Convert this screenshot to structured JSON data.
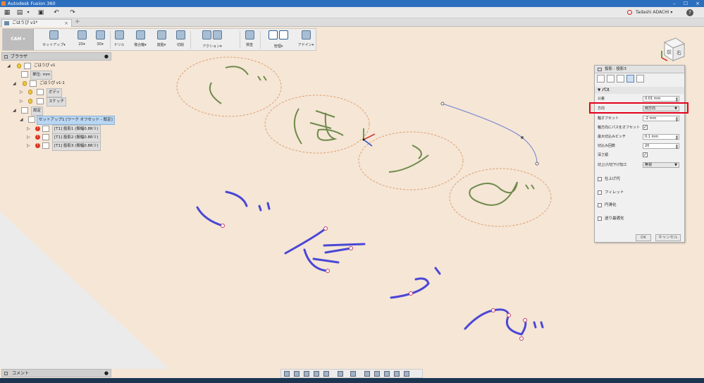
{
  "window": {
    "title": "Autodesk Fusion 360"
  },
  "qat": {
    "user_name": "Tadashi ADACHI ▾",
    "help": "?"
  },
  "doc_tab": {
    "label": "ごはうぴ v1*",
    "close": "×",
    "new_tab": "+"
  },
  "ribbon": {
    "workspace": "CAM ▾",
    "groups": [
      "セットアップ▾",
      "2D▾",
      "3D▾",
      "ドリル",
      "複合軸▾",
      "旋盤▾",
      "切削",
      "アクション▾",
      "検査",
      "管理▾",
      "アドイン▾"
    ]
  },
  "browser": {
    "title": "ブラウザ",
    "nodes": {
      "root": "ごはうぴ v1",
      "units": "単位: mm",
      "component": "ごはうぴ v1:1",
      "bodies": "ボディ",
      "sketches": "スケッチ",
      "setups": "設定",
      "setup1": "セットアップ1 [ワーク オフセット - 既定]",
      "op1": "[T1] 投影1 (振幅0.8Rリ)",
      "op2": "[T1] 投影2 (振幅0.8Rリ)",
      "op3": "[T1] 投影3 (振幅0.8Rリ)"
    }
  },
  "panel": {
    "title": "投影 : 投影3",
    "section_pass": "パス",
    "rows": {
      "tolerance_label": "公差",
      "tolerance_value": "0.01 mm",
      "direction_label": "方向",
      "direction_value": "両方向",
      "axial_offset_label": "軸オフセット",
      "axial_offset_value": "-2 mm",
      "multiple_depths_label": "軸方向にパスをオフセット",
      "max_stepdown_label": "最大切込みピッチ",
      "max_stepdown_value": "0.1 mm",
      "number_of_stepdowns_label": "切込み回数",
      "number_of_stepdowns_value": "20",
      "depth_first_label": "深さ順",
      "finishing_label": "切上げ/切下げ加工",
      "finishing_value": "無視"
    },
    "sections": {
      "finishing_passes": "仕上げ代",
      "fillet": "フィレット",
      "smoothing": "円滑化",
      "feed_optimization": "送り最適化"
    },
    "ok": "OK",
    "cancel": "キャンセル"
  },
  "viewcube": {
    "front": "前",
    "right": "右"
  },
  "comments": {
    "title": "コメント"
  },
  "colors": {
    "accent": "#2d6fbf",
    "highlight": "#e3001b",
    "toolpath": "#4b47d6",
    "sketch": "#6f8a4b",
    "guide": "#e0a070"
  }
}
